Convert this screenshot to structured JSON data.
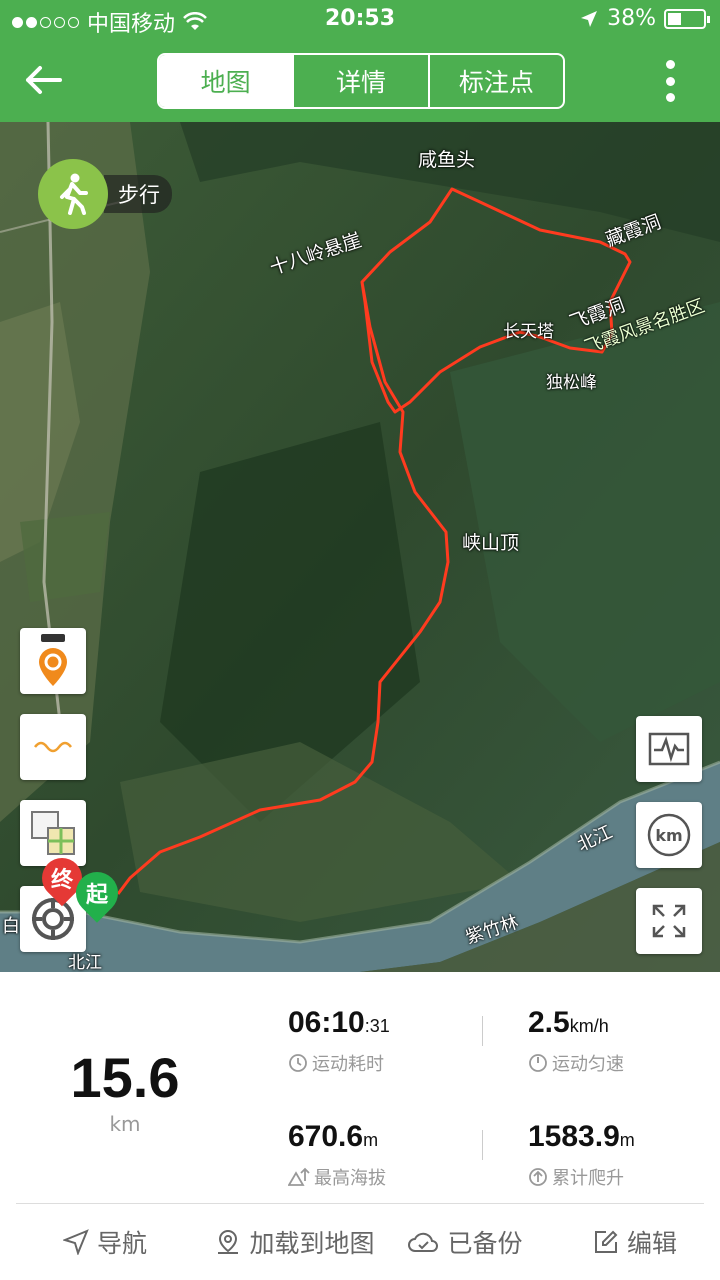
{
  "status_bar": {
    "carrier": "中国移动",
    "time": "20:53",
    "battery": "38%"
  },
  "header": {
    "tabs": [
      "地图",
      "详情",
      "标注点"
    ]
  },
  "map": {
    "mode_label": "步行",
    "labels": [
      "咸鱼头",
      "十八岭悬崖",
      "藏霞洞",
      "飞霞洞",
      "飞霞风景名胜区",
      "长天塔",
      "独松峰",
      "峡山顶",
      "北江",
      "紫竹林",
      "北江"
    ],
    "start_marker": "起",
    "end_marker": "终",
    "river_label_left": "白"
  },
  "stats": {
    "distance": {
      "value": "15.6",
      "unit": "km"
    },
    "duration": {
      "main": "06:10",
      "small": ":31",
      "label": "运动耗时"
    },
    "speed": {
      "main": "2.5",
      "small": "km/h",
      "label": "运动匀速"
    },
    "max_altitude": {
      "main": "670.6",
      "small": "m",
      "label": "最高海拔"
    },
    "total_climb": {
      "main": "1583.9",
      "small": "m",
      "label": "累计爬升"
    }
  },
  "bottom_bar": {
    "navigate": "导航",
    "load_map": "加载到地图",
    "backed_up": "已备份",
    "edit": "编辑"
  },
  "colors": {
    "primary": "#4caf50",
    "route": "#ff3b1f"
  }
}
